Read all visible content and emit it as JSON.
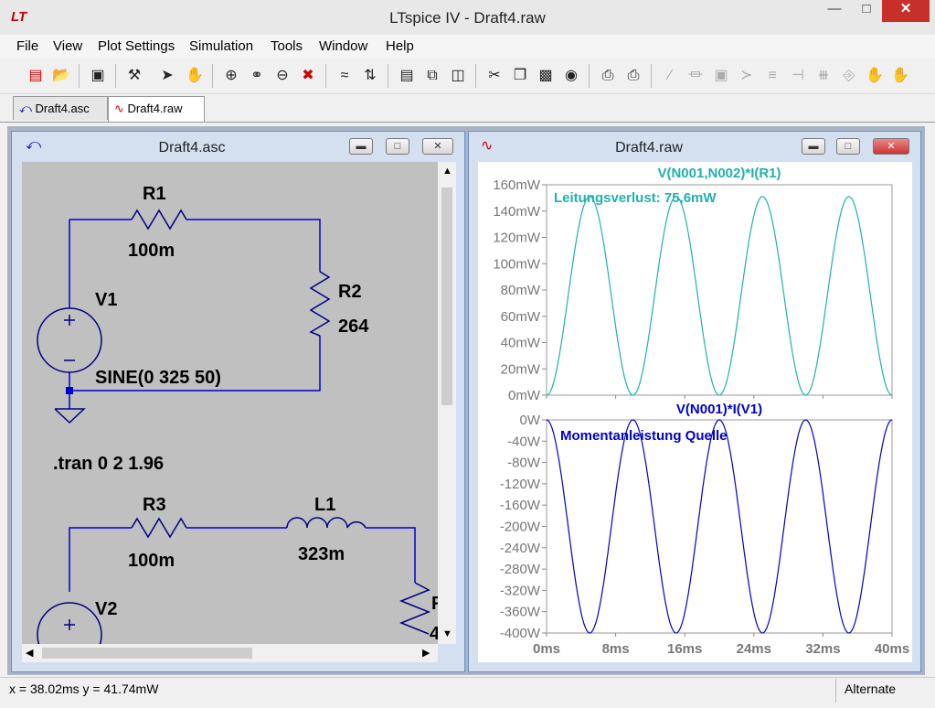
{
  "app": {
    "title": "LTspice IV - Draft4.raw",
    "logo": "LT",
    "window_controls": [
      "minimize-icon",
      "maximize-icon",
      "close-icon"
    ]
  },
  "menu": [
    "File",
    "View",
    "Plot Settings",
    "Simulation",
    "Tools",
    "Window",
    "Help"
  ],
  "toolbar_icons": [
    "new-schematic-icon",
    "open-icon",
    "save-icon",
    "control-panel-icon",
    "run-icon",
    "pan-icon",
    "zoom-in-icon",
    "zoom-out-icon",
    "zoom-back-icon",
    "zoom-fit-icon",
    "autorange-icon",
    "add-trace-icon",
    "tile-horizontal-icon",
    "cascade-icon",
    "tile-vertical-icon",
    "cut-icon",
    "copy-icon",
    "paste-icon",
    "find-icon",
    "print-preview-icon",
    "print-icon",
    "wire-icon",
    "ground-icon",
    "label-icon",
    "resistor-icon",
    "capacitor-icon",
    "inductor-icon",
    "diode-icon",
    "component-icon",
    "move-icon",
    "drag-icon"
  ],
  "tabs": [
    {
      "label": "Draft4.asc",
      "icon": "schematic-icon",
      "active": false
    },
    {
      "label": "Draft4.raw",
      "icon": "waveform-icon",
      "active": true
    }
  ],
  "schematic_window": {
    "title": "Draft4.asc",
    "components": {
      "r1": {
        "name": "R1",
        "value": "100m"
      },
      "r2": {
        "name": "R2",
        "value": "264"
      },
      "v1": {
        "name": "V1",
        "value": "SINE(0 325 50)"
      },
      "directive": ".tran 0 2 1.96",
      "r3": {
        "name": "R3",
        "value": "100m"
      },
      "l1": {
        "name": "L1",
        "value": "323m"
      },
      "v2": {
        "name": "V2"
      },
      "r4_partial": {
        "name": "R",
        "value": "4"
      }
    },
    "colors": {
      "wire": "#0000cc",
      "component": "#000080",
      "canvas": "#c0c0c0",
      "text": "#000000"
    }
  },
  "plot_window": {
    "title": "Draft4.raw",
    "panes": [
      {
        "trace_label": "V(N001,N002)*I(R1)",
        "annotation": "Leitungsverlust: 75,6mW",
        "color": "#20b2aa"
      },
      {
        "trace_label": "V(N001)*I(V1)",
        "annotation": "Momentanleistung Quelle",
        "color": "#0000cc"
      }
    ]
  },
  "chart_data": [
    {
      "type": "line",
      "title": "V(N001,N002)*I(R1)",
      "xlabel": "",
      "ylabel": "",
      "xlim": [
        0,
        40
      ],
      "x_unit": "ms",
      "ylim": [
        0,
        160
      ],
      "y_unit": "mW",
      "x_ticks": [
        "0ms",
        "8ms",
        "16ms",
        "24ms",
        "32ms",
        "40ms"
      ],
      "y_ticks": [
        "160mW",
        "140mW",
        "120mW",
        "100mW",
        "80mW",
        "60mW",
        "40mW",
        "20mW",
        "0mW"
      ],
      "series": [
        {
          "name": "V(N001,N002)*I(R1)",
          "color": "#20b2aa",
          "x": [
            0,
            5,
            10,
            15,
            20,
            25,
            30,
            35,
            40
          ],
          "y": [
            0,
            151,
            0,
            151,
            0,
            151,
            0,
            151,
            0
          ],
          "shape": "sin^2, period 10ms, peak 151mW"
        }
      ],
      "annotations": [
        "Leitungsverlust: 75,6mW"
      ],
      "grid": false
    },
    {
      "type": "line",
      "title": "V(N001)*I(V1)",
      "xlabel": "",
      "ylabel": "",
      "xlim": [
        0,
        40
      ],
      "x_unit": "ms",
      "ylim": [
        -400,
        0
      ],
      "y_unit": "W",
      "x_ticks": [
        "0ms",
        "8ms",
        "16ms",
        "24ms",
        "32ms",
        "40ms"
      ],
      "y_ticks": [
        "0W",
        "-40W",
        "-80W",
        "-120W",
        "-160W",
        "-200W",
        "-240W",
        "-280W",
        "-320W",
        "-360W",
        "-400W"
      ],
      "series": [
        {
          "name": "V(N001)*I(V1)",
          "color": "#0000cc",
          "x": [
            0,
            5,
            10,
            15,
            20,
            25,
            30,
            35,
            40
          ],
          "y": [
            0,
            -400,
            0,
            -400,
            0,
            -400,
            0,
            -400,
            0
          ],
          "shape": "-sin^2, period 10ms, peak -400W"
        }
      ],
      "annotations": [
        "Momentanleistung Quelle"
      ],
      "grid": false
    }
  ],
  "status": {
    "coords": "x = 38.02ms    y = 41.74mW",
    "mode": "Alternate"
  }
}
